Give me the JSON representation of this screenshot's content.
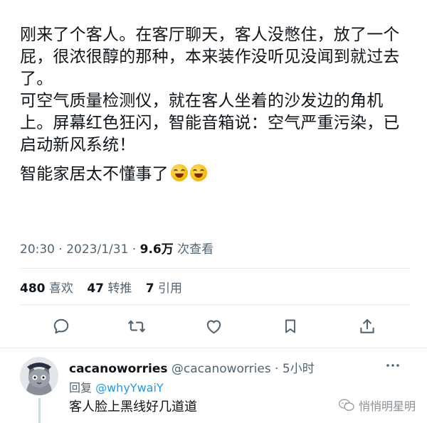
{
  "tweet": {
    "paragraph1": "刚来了个客人。在客厅聊天，客人没憋住，放了一个屁，很浓很醇的那种，本来装作没听见没闻到就过去了。",
    "paragraph2": "可空气质量检测仪，就在客人坐着的沙发边的角机上。屏幕红色狂闪，智能音箱说：空气严重污染，已启动新风系统！",
    "paragraph3": "智能家居太不懂事了",
    "emoji": [
      "grinning-squinting-face",
      "grinning-squinting-face"
    ]
  },
  "meta": {
    "time": "20:30",
    "sep": " · ",
    "date": "2023/1/31",
    "sep2": " · ",
    "views": "9.6万",
    "views_label": " 次查看"
  },
  "stats": {
    "likes_count": "480",
    "likes_label": "喜欢",
    "retweets_count": "47",
    "retweets_label": "转推",
    "quotes_count": "7",
    "quotes_label": "引用"
  },
  "actions": [
    {
      "name": "reply-icon"
    },
    {
      "name": "retweet-icon"
    },
    {
      "name": "like-icon"
    },
    {
      "name": "bookmark-icon"
    },
    {
      "name": "share-icon"
    }
  ],
  "reply": {
    "display_name": "cacanoworries",
    "handle": "@cacanoworries",
    "time_sep": " · ",
    "time": "5小时",
    "replying_label": "回复 ",
    "replying_to": "@whyYwaiY",
    "text": "客人脸上黑线好几道道"
  },
  "watermark": {
    "text": "悄悄明星明"
  },
  "colors": {
    "text": "#0f1419",
    "secondary": "#536471",
    "link": "#1d9bf0",
    "divider": "#e6e9eb"
  }
}
